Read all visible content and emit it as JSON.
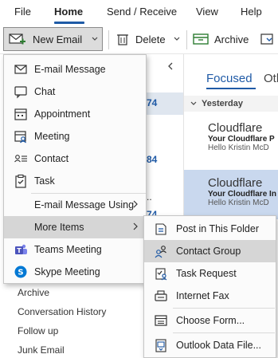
{
  "tabs": {
    "file": "File",
    "home": "Home",
    "send_receive": "Send / Receive",
    "view": "View",
    "help": "Help"
  },
  "toolbar": {
    "new_email": "New Email",
    "delete": "Delete",
    "archive": "Archive"
  },
  "mail": {
    "focused": "Focused",
    "other": "Oth",
    "group": "Yesterday",
    "items": [
      {
        "sender": "Cloudflare",
        "subject": "Your Cloudflare P",
        "preview": "Hello Kristin McD"
      },
      {
        "sender": "Cloudflare",
        "subject": "Your Cloudflare In",
        "preview": "Hello Kristin McD"
      }
    ]
  },
  "left_counts": [
    "74",
    "84",
    "74"
  ],
  "left_nav": [
    "Archive",
    "Conversation History",
    "Follow up",
    "Junk Email"
  ],
  "new_menu": {
    "items": [
      {
        "label": "E-mail Message",
        "icon": "envelope-icon"
      },
      {
        "label": "Chat",
        "icon": "chat-icon"
      },
      {
        "label": "Appointment",
        "icon": "calendar-icon"
      },
      {
        "label": "Meeting",
        "icon": "meeting-icon"
      },
      {
        "label": "Contact",
        "icon": "contact-card-icon"
      },
      {
        "label": "Task",
        "icon": "task-clipboard-icon"
      },
      {
        "label": "E-mail Message Using",
        "icon": ""
      },
      {
        "label": "More Items",
        "icon": ""
      },
      {
        "label": "Teams Meeting",
        "icon": "teams-icon"
      },
      {
        "label": "Skype Meeting",
        "icon": "skype-icon"
      }
    ]
  },
  "more_items_menu": {
    "items": [
      {
        "label": "Post in This Folder",
        "icon": "post-icon"
      },
      {
        "label": "Contact Group",
        "icon": "contact-group-icon"
      },
      {
        "label": "Task Request",
        "icon": "task-request-icon"
      },
      {
        "label": "Internet Fax",
        "icon": "fax-icon"
      },
      {
        "label": "Choose Form...",
        "icon": "form-icon"
      },
      {
        "label": "Outlook Data File...",
        "icon": "data-file-icon"
      }
    ]
  },
  "colors": {
    "accent": "#1f5aa6",
    "highlight": "#d6d6d6",
    "selected_mail": "#c9d8ee"
  }
}
